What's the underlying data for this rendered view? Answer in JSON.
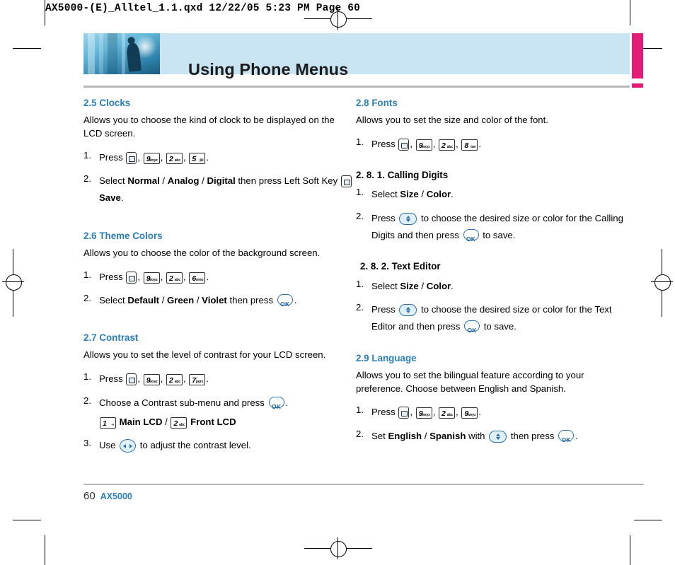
{
  "page": {
    "file_header": "AX5000-(E)_Alltel_1.1.qxd  12/22/05  5:23 PM  Page 60",
    "title": "Using Phone Menus",
    "footer_page": "60",
    "footer_model": "AX5000",
    "accent_color": "#2a7fb8",
    "band_color": "#c9e4f2",
    "tab_color": "#e41c78"
  },
  "left_column": {
    "clocks": {
      "heading": "2.5 Clocks",
      "intro": "Allows you to choose the kind of clock to be displayed on the LCD screen.",
      "steps": [
        {
          "num": "1.",
          "parts": [
            {
              "t": "text",
              "v": "Press "
            },
            {
              "t": "softkey"
            },
            {
              "t": "text",
              "v": ", "
            },
            {
              "t": "key",
              "digit": "9",
              "sub": "wxyz"
            },
            {
              "t": "text",
              "v": ", "
            },
            {
              "t": "key",
              "digit": "2",
              "sub": "abc"
            },
            {
              "t": "text",
              "v": ", "
            },
            {
              "t": "key",
              "digit": "5",
              "sub": "jkl"
            },
            {
              "t": "text",
              "v": "."
            }
          ]
        },
        {
          "num": "2.",
          "parts": [
            {
              "t": "text",
              "v": "Select "
            },
            {
              "t": "bold",
              "v": "Normal"
            },
            {
              "t": "text",
              "v": " / "
            },
            {
              "t": "bold",
              "v": "Analog"
            },
            {
              "t": "text",
              "v": " / "
            },
            {
              "t": "bold",
              "v": "Digital"
            },
            {
              "t": "text",
              "v": " then press Left Soft Key "
            },
            {
              "t": "softkey"
            },
            {
              "t": "bold",
              "v": " Save"
            },
            {
              "t": "text",
              "v": "."
            }
          ]
        }
      ]
    },
    "theme_colors": {
      "heading": "2.6 Theme Colors",
      "intro": "Allows you to choose the color of the background screen.",
      "steps": [
        {
          "num": "1.",
          "parts": [
            {
              "t": "text",
              "v": "Press "
            },
            {
              "t": "softkey"
            },
            {
              "t": "text",
              "v": ", "
            },
            {
              "t": "key",
              "digit": "9",
              "sub": "wxyz"
            },
            {
              "t": "text",
              "v": ", "
            },
            {
              "t": "key",
              "digit": "2",
              "sub": "abc"
            },
            {
              "t": "text",
              "v": ", "
            },
            {
              "t": "key",
              "digit": "6",
              "sub": "mno"
            },
            {
              "t": "text",
              "v": "."
            }
          ]
        },
        {
          "num": "2.",
          "parts": [
            {
              "t": "text",
              "v": "Select "
            },
            {
              "t": "bold",
              "v": "Default"
            },
            {
              "t": "text",
              "v": " / "
            },
            {
              "t": "bold",
              "v": "Green"
            },
            {
              "t": "text",
              "v": " / "
            },
            {
              "t": "bold",
              "v": "Violet"
            },
            {
              "t": "text",
              "v": " then press "
            },
            {
              "t": "ok"
            },
            {
              "t": "text",
              "v": "."
            }
          ]
        }
      ]
    },
    "contrast": {
      "heading": "2.7 Contrast",
      "intro": "Allows you to set the level of contrast for your LCD screen.",
      "steps": [
        {
          "num": "1.",
          "parts": [
            {
              "t": "text",
              "v": "Press "
            },
            {
              "t": "softkey"
            },
            {
              "t": "text",
              "v": ", "
            },
            {
              "t": "key",
              "digit": "9",
              "sub": "wxyz"
            },
            {
              "t": "text",
              "v": ", "
            },
            {
              "t": "key",
              "digit": "2",
              "sub": "abc"
            },
            {
              "t": "text",
              "v": ", "
            },
            {
              "t": "key",
              "digit": "7",
              "sub": "pqrs"
            },
            {
              "t": "text",
              "v": "."
            }
          ]
        },
        {
          "num": "2.",
          "parts": [
            {
              "t": "text",
              "v": "Choose a Contrast sub-menu and press "
            },
            {
              "t": "ok"
            },
            {
              "t": "text",
              "v": "."
            }
          ],
          "sub_parts": [
            {
              "t": "key",
              "digit": "1",
              "sub": "∞"
            },
            {
              "t": "bold",
              "v": " Main LCD"
            },
            {
              "t": "text",
              "v": " / "
            },
            {
              "t": "key",
              "digit": "2",
              "sub": "abc"
            },
            {
              "t": "bold",
              "v": " Front LCD"
            }
          ]
        },
        {
          "num": "3.",
          "parts": [
            {
              "t": "text",
              "v": "Use "
            },
            {
              "t": "leftright"
            },
            {
              "t": "text",
              "v": " to adjust the contrast level."
            }
          ]
        }
      ]
    }
  },
  "right_column": {
    "fonts": {
      "heading": "2.8 Fonts",
      "intro": "Allows you to set the size and color of the font.",
      "steps": [
        {
          "num": "1.",
          "parts": [
            {
              "t": "text",
              "v": "Press "
            },
            {
              "t": "softkey"
            },
            {
              "t": "text",
              "v": ", "
            },
            {
              "t": "key",
              "digit": "9",
              "sub": "wxyz"
            },
            {
              "t": "text",
              "v": ", "
            },
            {
              "t": "key",
              "digit": "2",
              "sub": "abc"
            },
            {
              "t": "text",
              "v": ", "
            },
            {
              "t": "key",
              "digit": "8",
              "sub": "tuv"
            },
            {
              "t": "text",
              "v": "."
            }
          ]
        }
      ],
      "calling_digits": {
        "heading": "2. 8. 1. Calling Digits",
        "steps": [
          {
            "num": "1.",
            "parts": [
              {
                "t": "text",
                "v": "Select "
              },
              {
                "t": "bold",
                "v": "Size"
              },
              {
                "t": "text",
                "v": " / "
              },
              {
                "t": "bold",
                "v": "Color"
              },
              {
                "t": "text",
                "v": "."
              }
            ]
          },
          {
            "num": "2.",
            "parts": [
              {
                "t": "text",
                "v": "Press "
              },
              {
                "t": "updown"
              },
              {
                "t": "text",
                "v": " to choose the desired size or color for the Calling Digits and then press "
              },
              {
                "t": "ok"
              },
              {
                "t": "text",
                "v": " to save."
              }
            ]
          }
        ]
      },
      "text_editor": {
        "heading": "2. 8. 2. Text Editor",
        "steps": [
          {
            "num": "1.",
            "parts": [
              {
                "t": "text",
                "v": "Select "
              },
              {
                "t": "bold",
                "v": "Size"
              },
              {
                "t": "text",
                "v": " / "
              },
              {
                "t": "bold",
                "v": "Color"
              },
              {
                "t": "text",
                "v": "."
              }
            ]
          },
          {
            "num": "2.",
            "parts": [
              {
                "t": "text",
                "v": "Press "
              },
              {
                "t": "updown"
              },
              {
                "t": "text",
                "v": " to choose the desired size or color for the Text Editor and then press "
              },
              {
                "t": "ok"
              },
              {
                "t": "text",
                "v": " to save."
              }
            ]
          }
        ]
      }
    },
    "language": {
      "heading": "2.9 Language",
      "intro": "Allows you to set the bilingual feature according to your preference. Choose between English and Spanish.",
      "steps": [
        {
          "num": "1.",
          "parts": [
            {
              "t": "text",
              "v": "Press "
            },
            {
              "t": "softkey"
            },
            {
              "t": "text",
              "v": ", "
            },
            {
              "t": "key",
              "digit": "9",
              "sub": "wxyz"
            },
            {
              "t": "text",
              "v": ", "
            },
            {
              "t": "key",
              "digit": "2",
              "sub": "abc"
            },
            {
              "t": "text",
              "v": ", "
            },
            {
              "t": "key",
              "digit": "9",
              "sub": "wxyz"
            },
            {
              "t": "text",
              "v": "."
            }
          ]
        },
        {
          "num": "2.",
          "parts": [
            {
              "t": "text",
              "v": "Set "
            },
            {
              "t": "bold",
              "v": "English"
            },
            {
              "t": "text",
              "v": " / "
            },
            {
              "t": "bold",
              "v": "Spanish"
            },
            {
              "t": "text",
              "v": " with "
            },
            {
              "t": "updown"
            },
            {
              "t": "text",
              "v": " then press "
            },
            {
              "t": "ok"
            },
            {
              "t": "text",
              "v": "."
            }
          ]
        }
      ]
    }
  },
  "icons": {
    "ok_label": "OK"
  }
}
